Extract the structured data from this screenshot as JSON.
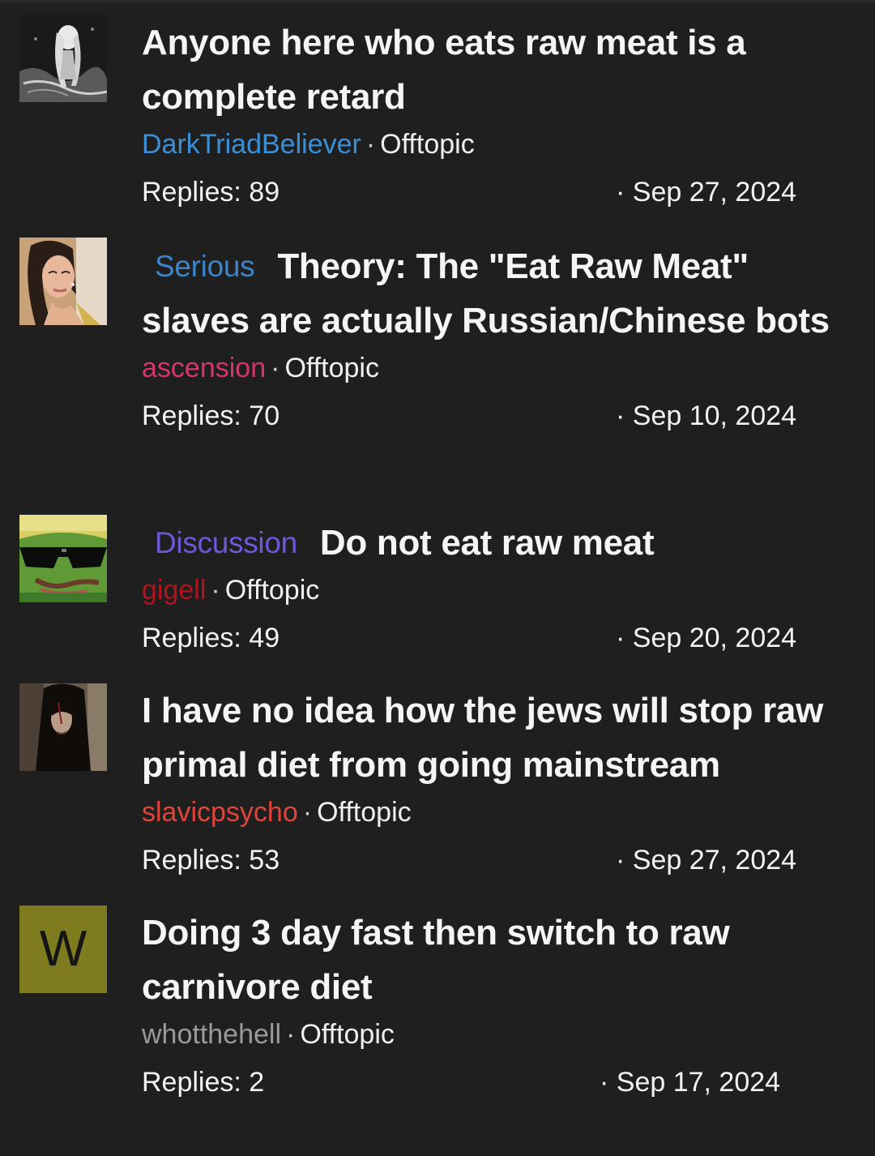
{
  "threads": [
    {
      "avatar": "anime-girl-avatar",
      "prefix": "",
      "title": "Anyone here who eats raw meat is a complete retard",
      "author": "DarkTriadBeliever",
      "author_color": "#3b8fd6",
      "forum": "Offtopic",
      "replies": "Replies: 89",
      "date": "Sep 27, 2024"
    },
    {
      "avatar": "woman-portrait-avatar",
      "prefix": "Serious",
      "prefix_color": "#3d84c6",
      "title": "Theory: The \"Eat Raw Meat\" slaves are actually Russian/Chinese bots",
      "author": "ascension",
      "author_color": "#d6366a",
      "forum": "Offtopic",
      "replies": "Replies: 70",
      "date": "Sep 10, 2024"
    },
    {
      "avatar": "pepe-sunglasses-avatar",
      "prefix": "Discussion",
      "prefix_color": "#6a59d9",
      "title": "Do not eat raw meat",
      "author": "gigell",
      "author_color": "#b3131c",
      "forum": "Offtopic",
      "replies": "Replies: 49",
      "date": "Sep 20, 2024"
    },
    {
      "avatar": "dark-hair-person-avatar",
      "prefix": "",
      "title": "I have no idea how the jews will stop raw primal diet from going mainstream",
      "author": "slavicpsycho",
      "author_color": "#e0443a",
      "forum": "Offtopic",
      "replies": "Replies: 53",
      "date": "Sep 27, 2024"
    },
    {
      "avatar": "letter-w-avatar",
      "avatar_letter": "W",
      "avatar_color": "#7f7b1f",
      "prefix": "",
      "title": "Doing 3 day fast then switch to raw carnivore diet",
      "author": "whotthehell",
      "author_color": "#9a9a9a",
      "forum": "Offtopic",
      "replies": "Replies: 2",
      "date": "Sep 17, 2024"
    }
  ]
}
